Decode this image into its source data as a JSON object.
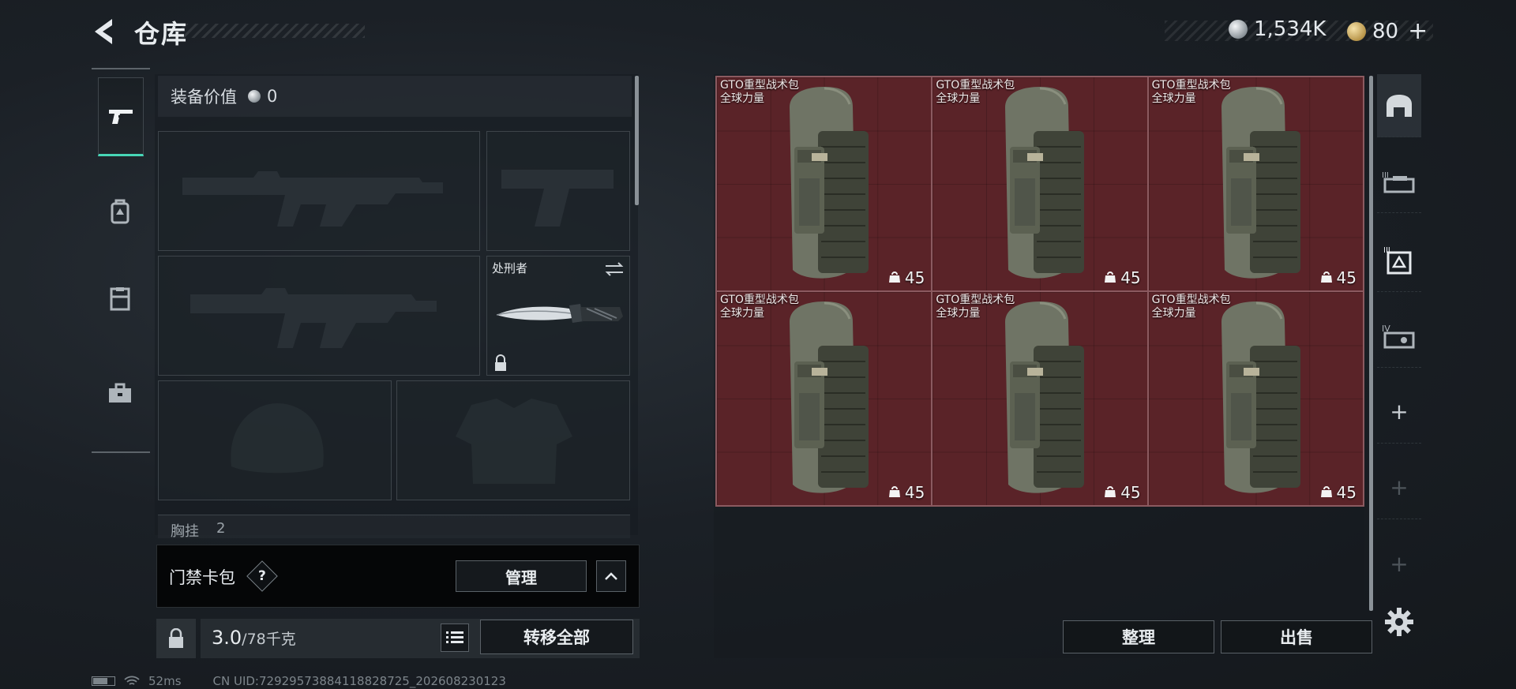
{
  "header": {
    "title": "仓库",
    "currency_silver": "1,534K",
    "currency_gold": "80",
    "add_symbol": "+"
  },
  "left_rail": {
    "items": [
      {
        "name": "weapons",
        "icon": "pistol-icon",
        "active": true
      },
      {
        "name": "backpacks",
        "icon": "backpack-icon",
        "active": false
      },
      {
        "name": "chest-rigs",
        "icon": "chest-rig-icon",
        "active": false
      },
      {
        "name": "supplies",
        "icon": "toolbox-icon",
        "active": false
      }
    ]
  },
  "equipment": {
    "value_label": "装备价值",
    "value": "0",
    "melee_slot_label": "处刑者",
    "chest_rig_label": "胸挂",
    "chest_rig_count": "2"
  },
  "access_card": {
    "label": "门禁卡包",
    "help": "?",
    "manage_label": "管理"
  },
  "weight": {
    "current": "3.0",
    "max": "/78千克",
    "transfer_all_label": "转移全部"
  },
  "status_bar": {
    "ping": "52ms",
    "uid": "CN UID:7292957388411882872​5_202608230123"
  },
  "storage": {
    "items": [
      {
        "name": "GTO重型战术包",
        "tag": "全球力量",
        "qty": "45"
      },
      {
        "name": "GTO重型战术包",
        "tag": "全球力量",
        "qty": "45"
      },
      {
        "name": "GTO重型战术包",
        "tag": "全球力量",
        "qty": "45"
      },
      {
        "name": "GTO重型战术包",
        "tag": "全球力量",
        "qty": "45"
      },
      {
        "name": "GTO重型战术包",
        "tag": "全球力量",
        "qty": "45"
      },
      {
        "name": "GTO重型战术包",
        "tag": "全球力量",
        "qty": "45"
      }
    ],
    "sort_label": "整理",
    "sell_label": "出售"
  },
  "right_rail": {
    "items": [
      "stash-home-icon",
      "container-2-icon",
      "container-3-icon",
      "container-4-icon",
      "add-container",
      "add-container",
      "add-container"
    ],
    "add_symbol": "+"
  },
  "colors": {
    "accent": "#47d6b6",
    "item_bg": "#5a2328",
    "item_border": "#8b5a60"
  }
}
